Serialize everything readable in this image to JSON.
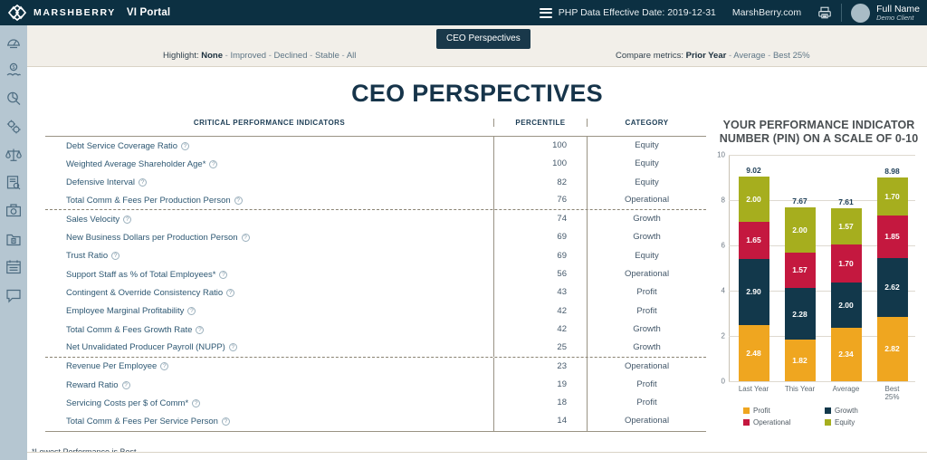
{
  "topbar": {
    "brand": "MARSHBERRY",
    "portal": "VI Portal",
    "menu_icon": "hamburger-icon",
    "effective_date": "PHP Data Effective Date: 2019-12-31",
    "site_link": "MarshBerry.com",
    "print_icon": "printer-icon",
    "user_name": "Full Name",
    "user_role": "Demo Client"
  },
  "sidebar": {
    "items": [
      {
        "icon": "dashboard-icon"
      },
      {
        "icon": "dollar-network-icon"
      },
      {
        "icon": "pie-search-icon"
      },
      {
        "icon": "gears-icon"
      },
      {
        "icon": "scales-icon"
      },
      {
        "icon": "document-search-icon"
      },
      {
        "icon": "camera-report-icon"
      },
      {
        "icon": "folder-archive-icon"
      },
      {
        "icon": "calendar-icon"
      },
      {
        "icon": "chat-icon"
      }
    ]
  },
  "subbar": {
    "tab_label": "CEO Perspectives",
    "highlight": {
      "label": "Highlight:",
      "options": [
        "None",
        "Improved",
        "Declined",
        "Stable",
        "All"
      ],
      "selected": "None"
    },
    "compare": {
      "label": "Compare metrics:",
      "options": [
        "Prior Year",
        "Average",
        "Best 25%"
      ],
      "selected": "Prior Year"
    }
  },
  "page_title": "CEO PERSPECTIVES",
  "table": {
    "headers": [
      "CRITICAL PERFORMANCE INDICATORS",
      "PERCENTILE",
      "CATEGORY"
    ],
    "help_icon": "question-mark-icon",
    "separator_after_rows": [
      3,
      11
    ],
    "rows": [
      {
        "name": "Debt Service Coverage Ratio",
        "percentile": "100",
        "category": "Equity"
      },
      {
        "name": "Weighted Average Shareholder Age*",
        "percentile": "100",
        "category": "Equity"
      },
      {
        "name": "Defensive Interval",
        "percentile": "82",
        "category": "Equity"
      },
      {
        "name": "Total Comm & Fees Per Production Person",
        "percentile": "76",
        "category": "Operational"
      },
      {
        "name": "Sales Velocity",
        "percentile": "74",
        "category": "Growth"
      },
      {
        "name": "New Business Dollars per Production Person",
        "percentile": "69",
        "category": "Growth"
      },
      {
        "name": "Trust Ratio",
        "percentile": "69",
        "category": "Equity"
      },
      {
        "name": "Support Staff as % of Total Employees*",
        "percentile": "56",
        "category": "Operational"
      },
      {
        "name": "Contingent & Override Consistency Ratio",
        "percentile": "43",
        "category": "Profit"
      },
      {
        "name": "Employee Marginal Profitability",
        "percentile": "42",
        "category": "Profit"
      },
      {
        "name": "Total Comm & Fees Growth Rate",
        "percentile": "42",
        "category": "Growth"
      },
      {
        "name": "Net Unvalidated Producer Payroll (NUPP)",
        "percentile": "25",
        "category": "Growth"
      },
      {
        "name": "Revenue Per Employee",
        "percentile": "23",
        "category": "Operational"
      },
      {
        "name": "Reward Ratio",
        "percentile": "19",
        "category": "Profit"
      },
      {
        "name": "Servicing Costs per $ of Comm*",
        "percentile": "18",
        "category": "Profit"
      },
      {
        "name": "Total Comm & Fees Per Service Person",
        "percentile": "14",
        "category": "Operational"
      }
    ],
    "footnote": "*Lowest Performance is Best"
  },
  "chart_data": {
    "type": "bar",
    "stacked": true,
    "title": "YOUR PERFORMANCE INDICATOR NUMBER (PIN) ON A SCALE OF 0-10",
    "xlabel": "",
    "ylabel": "",
    "ylim": [
      0,
      10
    ],
    "yticks": [
      "0",
      "2",
      "4",
      "6",
      "8",
      "10"
    ],
    "grid": true,
    "legend_position": "bottom",
    "categories": [
      "Last Year",
      "This Year",
      "Average",
      "Best 25%"
    ],
    "totals": [
      "9.02",
      "7.67",
      "7.61",
      "8.98"
    ],
    "series": [
      {
        "name": "Profit",
        "color": "#EFA620",
        "values": [
          2.48,
          1.82,
          2.34,
          2.82
        ],
        "labels": [
          "2.48",
          "1.82",
          "2.34",
          "2.82"
        ]
      },
      {
        "name": "Growth",
        "color": "#12384B",
        "values": [
          2.9,
          2.28,
          2.0,
          2.62
        ],
        "labels": [
          "2.90",
          "2.28",
          "2.00",
          "2.62"
        ]
      },
      {
        "name": "Operational",
        "color": "#C4183F",
        "values": [
          1.65,
          1.57,
          1.7,
          1.85
        ],
        "labels": [
          "1.65",
          "1.57",
          "1.70",
          "1.85"
        ]
      },
      {
        "name": "Equity",
        "color": "#A6AE1E",
        "values": [
          2.0,
          2.0,
          1.57,
          1.7
        ],
        "labels": [
          "2.00",
          "2.00",
          "1.57",
          "1.70"
        ]
      }
    ]
  },
  "colors": {
    "navy": "#0c3042",
    "sidebar": "#b5c6d1",
    "subbar": "#f2efe9",
    "title": "#16344a",
    "profit": "#EFA620",
    "growth": "#12384B",
    "operational": "#C4183F",
    "equity": "#A6AE1E"
  }
}
